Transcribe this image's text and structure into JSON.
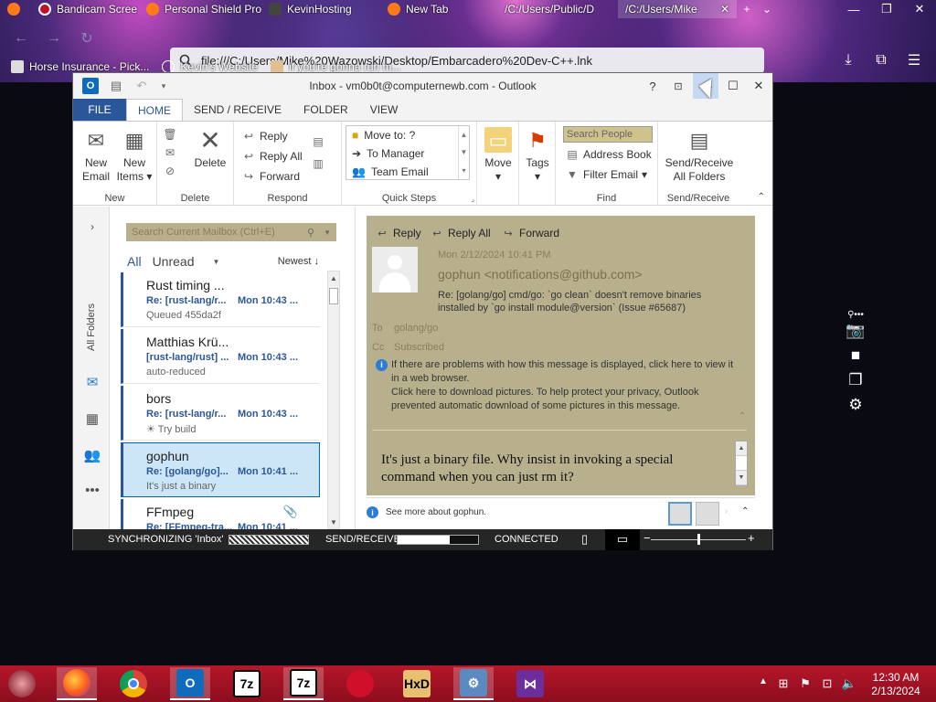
{
  "browser": {
    "tabs": [
      {
        "label": "Bandicam Scree",
        "icon": "bandicam-icon"
      },
      {
        "label": "Personal Shield Pro",
        "icon": "firefox-icon"
      },
      {
        "label": "KevinHosting",
        "icon": "kevinhosting-icon"
      },
      {
        "label": "New Tab",
        "icon": "firefox-icon"
      },
      {
        "label": "/C:/Users/Public/D",
        "icon": "file-icon"
      },
      {
        "label": "/C:/Users/Mike",
        "icon": "file-icon"
      }
    ],
    "url": "file:///C:/Users/Mike%20Wazowski/Desktop/Embarcadero%20Dev-C++.lnk",
    "bookmarks": [
      "Horse Insurance - Pick...",
      "Kevin's Website",
      "if you're gonna run m..."
    ]
  },
  "outlook": {
    "title": "Inbox - vm0b0t@computernewb.com - Outlook",
    "menu_tabs": [
      "FILE",
      "HOME",
      "SEND / RECEIVE",
      "FOLDER",
      "VIEW"
    ],
    "ribbon": {
      "new_email": [
        "New",
        "Email"
      ],
      "new_items": [
        "New",
        "Items"
      ],
      "delete": "Delete",
      "reply": "Reply",
      "reply_all": "Reply All",
      "forward": "Forward",
      "quick_steps": [
        "Move to: ?",
        "To Manager",
        "Team Email"
      ],
      "move": "Move",
      "tags": "Tags",
      "search_people": "Search People",
      "address_book": "Address Book",
      "filter_email": "Filter Email",
      "send_receive_all": [
        "Send/Receive",
        "All Folders"
      ],
      "groups": [
        "New",
        "Delete",
        "Respond",
        "Quick Steps",
        "Move",
        "Tags",
        "Find",
        "Send/Receive"
      ]
    },
    "rail": {
      "all_folders": "All Folders"
    },
    "mail_list": {
      "search_placeholder": "Search Current Mailbox (Ctrl+E)",
      "filter_all": "All",
      "filter_unread": "Unread",
      "sort": "Newest",
      "items": [
        {
          "from": "Rust timing ...",
          "subject": "Re: [rust-lang/r...",
          "time": "Mon 10:43 ...",
          "preview": "Queued 455da2f"
        },
        {
          "from": "Matthias Krü...",
          "subject": "[rust-lang/rust] ...",
          "time": "Mon 10:43 ...",
          "preview": "auto-reduced"
        },
        {
          "from": "bors",
          "subject": "Re: [rust-lang/r...",
          "time": "Mon 10:43 ...",
          "preview": "☀ Try build"
        },
        {
          "from": "gophun",
          "subject": "Re: [golang/go]...",
          "time": "Mon 10:41 ...",
          "preview": "It's just a binary"
        },
        {
          "from": "FFmpeg",
          "subject": "Re: [FFmpeg-tra...",
          "time": "Mon 10:41 ...",
          "preview": ""
        }
      ]
    },
    "reading": {
      "reply": "Reply",
      "reply_all": "Reply All",
      "forward": "Forward",
      "date": "Mon 2/12/2024 10:41 PM",
      "from": "gophun <notifications@github.com>",
      "subject": "Re: [golang/go] cmd/go: `go clean` doesn't remove binaries installed by `go install module@version` (Issue #65687)",
      "to_label": "To",
      "to_value": "golang/go",
      "cc_label": "Cc",
      "cc_value": "Subscribed",
      "info1": "If there are problems with how this message is displayed, click here to view it in a web browser.",
      "info2": "Click here to download pictures. To help protect your privacy, Outlook prevented automatic download of some pictures in this message.",
      "body": "It's just a binary file. Why insist in invoking a special command when you can just rm it?",
      "see_more": "See more about gophun."
    },
    "status": {
      "sync": "SYNCHRONIZING 'Inbox'",
      "send_receive": "SEND/RECEIVE",
      "send_receive_progress": 0.65,
      "connected": "CONNECTED",
      "zoom_level": 0.5
    }
  },
  "taskbar": {
    "apps": [
      "firefox",
      "chrome",
      "outlook",
      "7-zip",
      "7-zip",
      "bandicam",
      "hxd",
      "control-panel",
      "visual-studio"
    ],
    "time": "12:30 AM",
    "date": "2/13/2024"
  },
  "colors": {
    "accent": "#2b579a",
    "taskbar": "#a8122a",
    "reading_bg": "#b8b08c"
  }
}
